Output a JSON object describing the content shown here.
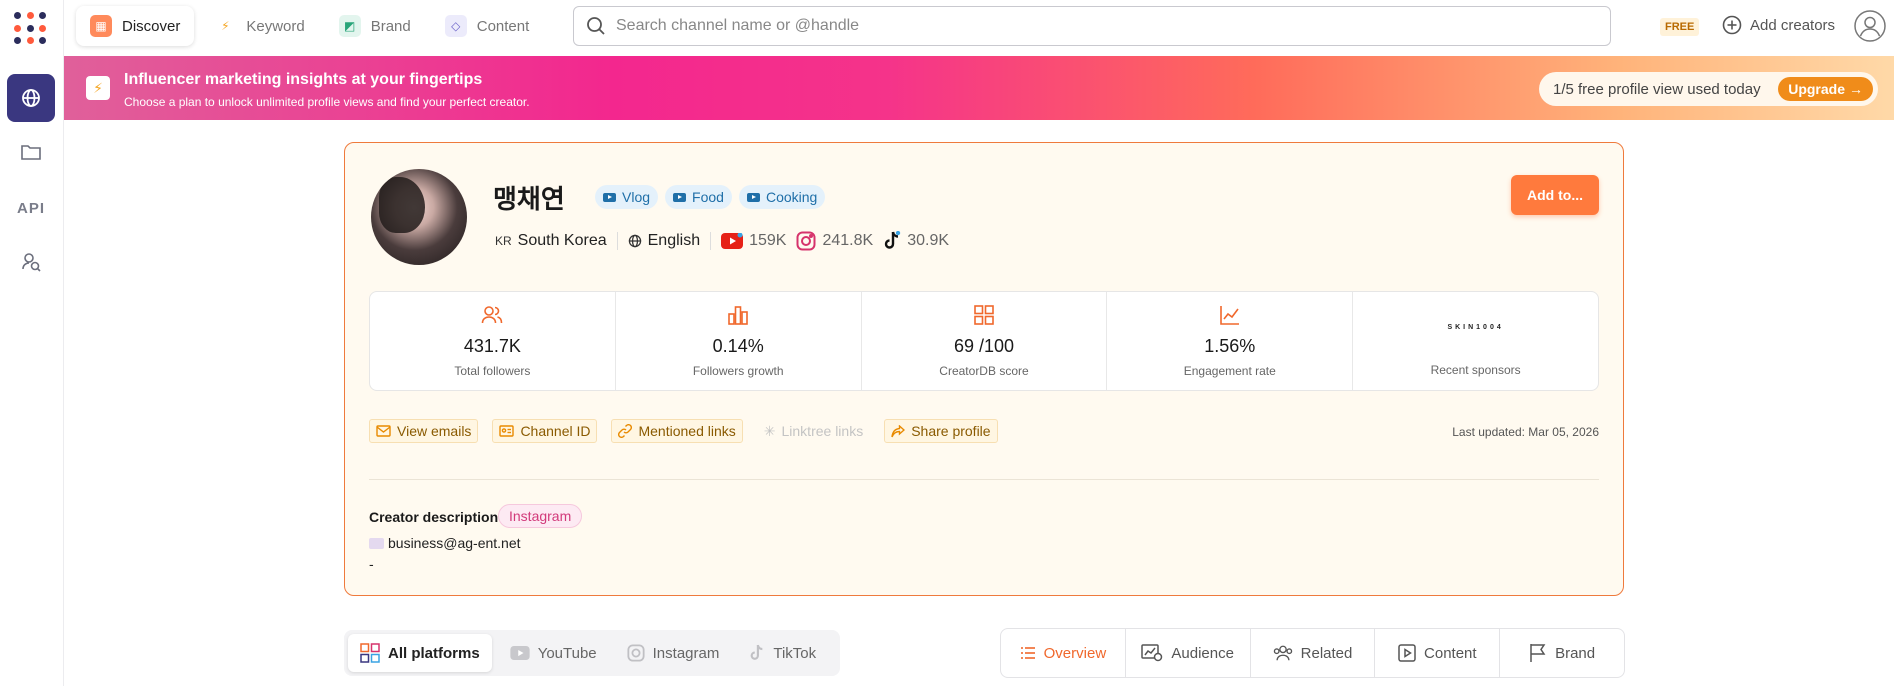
{
  "nav": {
    "tabs": [
      {
        "label": "Discover"
      },
      {
        "label": "Keyword"
      },
      {
        "label": "Brand"
      },
      {
        "label": "Content"
      }
    ],
    "search_placeholder": "Search channel name or @handle",
    "plan_badge": "FREE",
    "add_creators": "Add creators"
  },
  "rail": {
    "api_label": "API"
  },
  "banner": {
    "title": "Influencer marketing insights at your fingertips",
    "subtitle": "Choose a plan to unlock unlimited profile views and find your perfect creator.",
    "usage": "1/5 free profile view used today",
    "upgrade": "Upgrade"
  },
  "profile": {
    "name": "맹채연",
    "tags": [
      "Vlog",
      "Food",
      "Cooking"
    ],
    "country_code": "KR",
    "country": "South Korea",
    "language": "English",
    "youtube_followers": "159K",
    "instagram_followers": "241.8K",
    "tiktok_followers": "30.9K",
    "add_button": "Add to..."
  },
  "stats": [
    {
      "value": "431.7K",
      "label": "Total followers"
    },
    {
      "value": "0.14%",
      "label": "Followers growth"
    },
    {
      "value": "69 /100",
      "label": "CreatorDB score"
    },
    {
      "value": "1.56%",
      "label": "Engagement rate"
    },
    {
      "sponsor": "SKIN1004",
      "label": "Recent sponsors"
    }
  ],
  "links": {
    "emails": "View emails",
    "channel_id": "Channel ID",
    "mentioned": "Mentioned links",
    "linktree": "Linktree links",
    "share": "Share profile",
    "updated": "Last updated: Mar 05, 2026"
  },
  "description": {
    "title": "Creator description",
    "source": "Instagram",
    "email": "business@ag-ent.net",
    "extra": "-"
  },
  "platform_tabs": [
    "All platforms",
    "YouTube",
    "Instagram",
    "TikTok"
  ],
  "view_tabs": [
    "Overview",
    "Audience",
    "Related",
    "Content",
    "Brand"
  ],
  "colors": {
    "accent": "#ff7a3d",
    "rail_active": "#3a3780",
    "tag_blue": "#1f6fa8"
  }
}
